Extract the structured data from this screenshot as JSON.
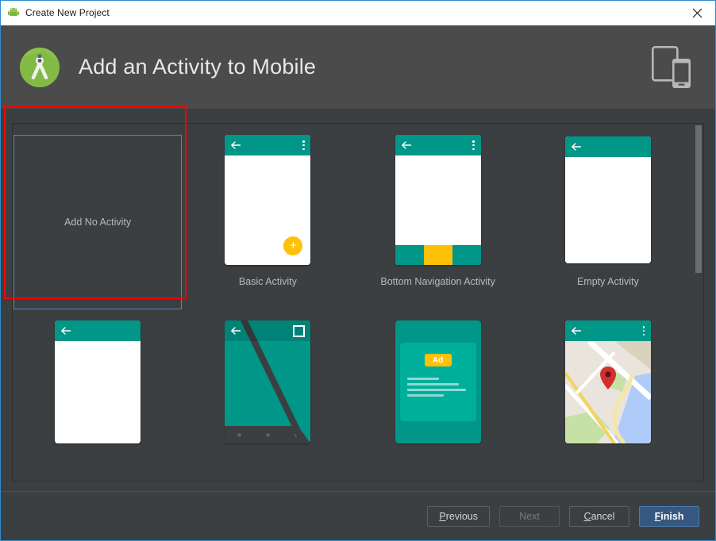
{
  "window": {
    "title": "Create New Project",
    "title_icon": "android-robot-icon",
    "close_icon": "close-icon"
  },
  "header": {
    "logo_icon": "android-studio-logo-icon",
    "title": "Add an Activity to Mobile",
    "device_icon": "tablet-and-phone-icon"
  },
  "gallery": {
    "no_activity": {
      "label": "Add No Activity",
      "selected": true,
      "highlight_color": "#ff0000",
      "selection_border_color": "#5784bf"
    },
    "items": [
      {
        "label": "Basic Activity",
        "thumb": "basic-activity-thumb"
      },
      {
        "label": "Bottom Navigation Activity",
        "thumb": "bottom-navigation-activity-thumb"
      },
      {
        "label": "Empty Activity",
        "thumb": "empty-activity-thumb"
      },
      {
        "label": "",
        "thumb": "fullscreen-row2-item1-thumb"
      },
      {
        "label": "",
        "thumb": "fullscreen-activity-thumb"
      },
      {
        "label": "",
        "thumb": "admob-ads-activity-thumb"
      },
      {
        "label": "",
        "thumb": "google-maps-activity-thumb"
      }
    ],
    "ad_badge_label": "Ad",
    "scrollbar": {
      "name": "vertical-scrollbar",
      "thumb_position": "top"
    }
  },
  "footer": {
    "buttons": [
      {
        "label": "Previous",
        "mnemonic": "P",
        "state": "enabled",
        "style": "default"
      },
      {
        "label": "Next",
        "mnemonic": "N",
        "state": "disabled",
        "style": "default"
      },
      {
        "label": "Cancel",
        "mnemonic": "C",
        "state": "enabled",
        "style": "default"
      },
      {
        "label": "Finish",
        "mnemonic": "F",
        "state": "enabled",
        "style": "primary"
      }
    ]
  },
  "colors": {
    "window_border": "#2d8ccd",
    "header_bg": "#4b4b4b",
    "body_bg": "#3c3f41",
    "teal": "#009688",
    "amber": "#ffc107",
    "primary_button": "#365880",
    "map_pin": "#d32f2f"
  }
}
